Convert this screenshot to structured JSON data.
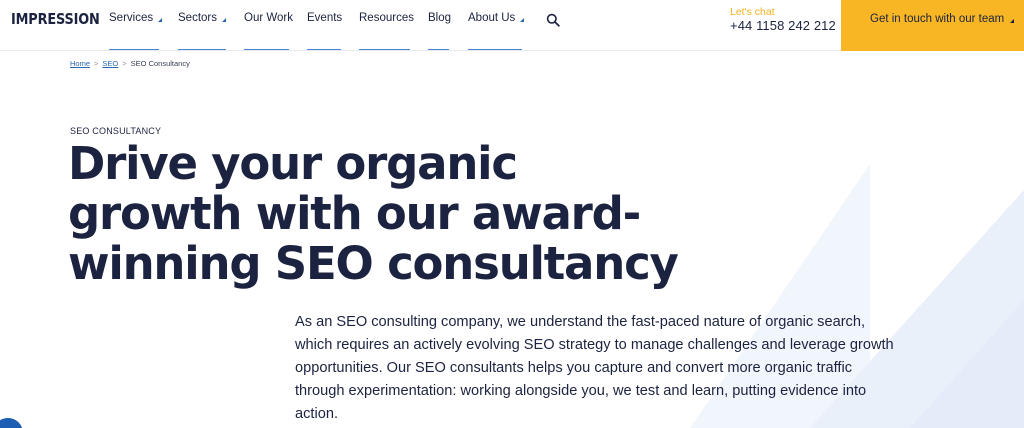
{
  "header": {
    "logo": "IMPRESSION",
    "nav": [
      {
        "label": "Services",
        "dropdown": true
      },
      {
        "label": "Sectors",
        "dropdown": true
      },
      {
        "label": "Our Work",
        "dropdown": false
      },
      {
        "label": "Events",
        "dropdown": false
      },
      {
        "label": "Resources",
        "dropdown": false
      },
      {
        "label": "Blog",
        "dropdown": false
      },
      {
        "label": "About Us",
        "dropdown": true
      }
    ],
    "search_icon": "search-icon",
    "chat_label": "Let's chat",
    "phone": "+44 1158 242 212",
    "cta_label": "Get in touch with our team"
  },
  "breadcrumb": {
    "home": "Home",
    "seo": "SEO",
    "current": "SEO Consultancy",
    "separator": ">"
  },
  "hero": {
    "eyebrow": "SEO CONSULTANCY",
    "headline_line1": "Drive your organic",
    "headline_line2": "growth with our award-",
    "headline_line3": "winning SEO consultancy",
    "intro": "As an SEO consulting company, we understand the fast-paced nature of organic search, which requires an actively evolving SEO strategy to manage challenges and leverage growth opportunities. Our SEO consultants helps you capture and convert more organic traffic through experimentation: working alongside you, we test and learn, putting evidence into action."
  },
  "colors": {
    "brand_navy": "#1c2340",
    "accent_yellow": "#f8b624",
    "link_blue": "#2a67b3",
    "deco_blue": "#eaf1fb"
  }
}
